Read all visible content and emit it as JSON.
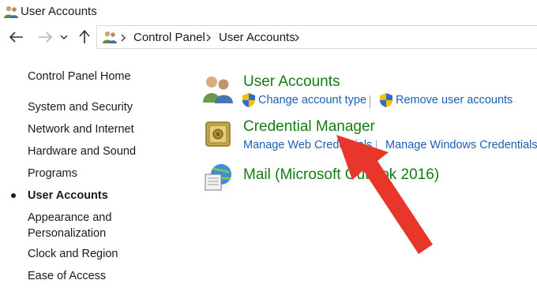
{
  "window": {
    "title": "User Accounts",
    "title_icon": "user-accounts-icon"
  },
  "nav": {
    "back_icon": "arrow-left-icon",
    "forward_icon": "arrow-right-icon",
    "recent_icon": "chevron-down-icon",
    "up_icon": "arrow-up-icon",
    "breadcrumb": [
      "Control Panel",
      "User Accounts"
    ]
  },
  "sidebar": {
    "items": [
      {
        "label": "Control Panel Home"
      },
      {
        "label": "System and Security"
      },
      {
        "label": "Network and Internet"
      },
      {
        "label": "Hardware and Sound"
      },
      {
        "label": "Programs"
      },
      {
        "label": "User Accounts",
        "active": true
      },
      {
        "label": "Appearance and"
      },
      {
        "label": "Personalization"
      },
      {
        "label": "Clock and Region"
      },
      {
        "label": "Ease of Access"
      }
    ]
  },
  "main": {
    "categories": [
      {
        "title": "User Accounts",
        "icon": "user-accounts-icon",
        "tasks": [
          "Change account type",
          "Remove user accounts"
        ]
      },
      {
        "title": "Credential Manager",
        "icon": "vault-icon",
        "tasks": [
          "Manage Web Credentials",
          "Manage Windows Credentials"
        ]
      },
      {
        "title": "Mail (Microsoft Outlook 2016)",
        "icon": "mail-icon",
        "tasks": []
      }
    ]
  },
  "annotation": {
    "type": "red-arrow",
    "color": "#e8362b"
  },
  "colors": {
    "category_title": "#127d12",
    "link": "#1a5fb4",
    "text": "#1a1a1a"
  }
}
